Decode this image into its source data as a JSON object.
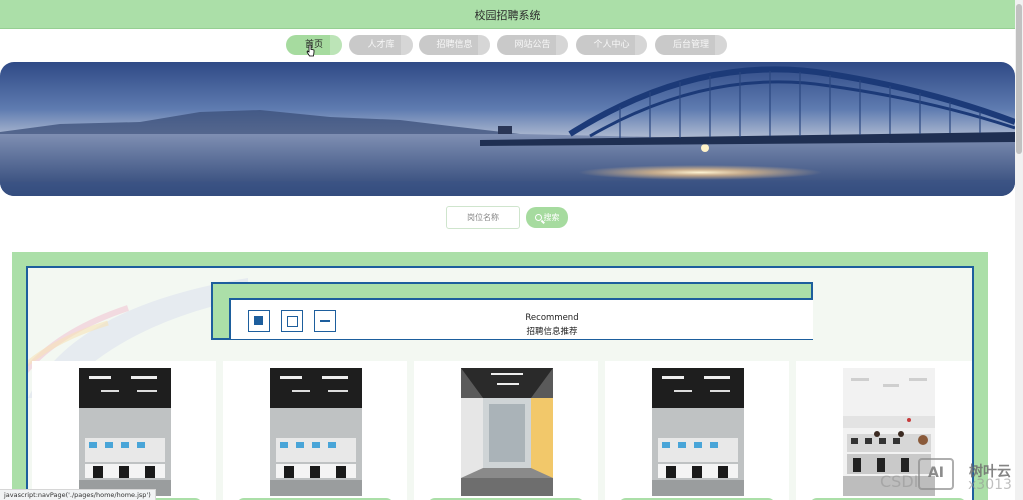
{
  "header": {
    "title": "校园招聘系统"
  },
  "nav": {
    "items": [
      {
        "label": "首页",
        "active": true
      },
      {
        "label": "人才库",
        "active": false
      },
      {
        "label": "招聘信息",
        "active": false
      },
      {
        "label": "网站公告",
        "active": false
      },
      {
        "label": "个人中心",
        "active": false
      },
      {
        "label": "后台管理",
        "active": false
      }
    ]
  },
  "search": {
    "placeholder": "岗位名称",
    "button_label": "搜索"
  },
  "recommend": {
    "title_en": "Recommend",
    "title_cn": "招聘信息推荐"
  },
  "cards": [
    {
      "photo": "office-workstations"
    },
    {
      "photo": "office-workstations"
    },
    {
      "photo": "office-corridor"
    },
    {
      "photo": "office-workstations"
    },
    {
      "photo": "office-people"
    }
  ],
  "status_bar": {
    "text": "javascript:navPage('./pages/home/home.jsp')"
  },
  "watermark": {
    "left": "CSDI",
    "logo": "AI",
    "brand": "树叶云",
    "user": "x3013"
  },
  "colors": {
    "accent_green": "#abdfa8",
    "frame_blue": "#1d5e9d",
    "inactive_gray": "#c9c9c9"
  }
}
